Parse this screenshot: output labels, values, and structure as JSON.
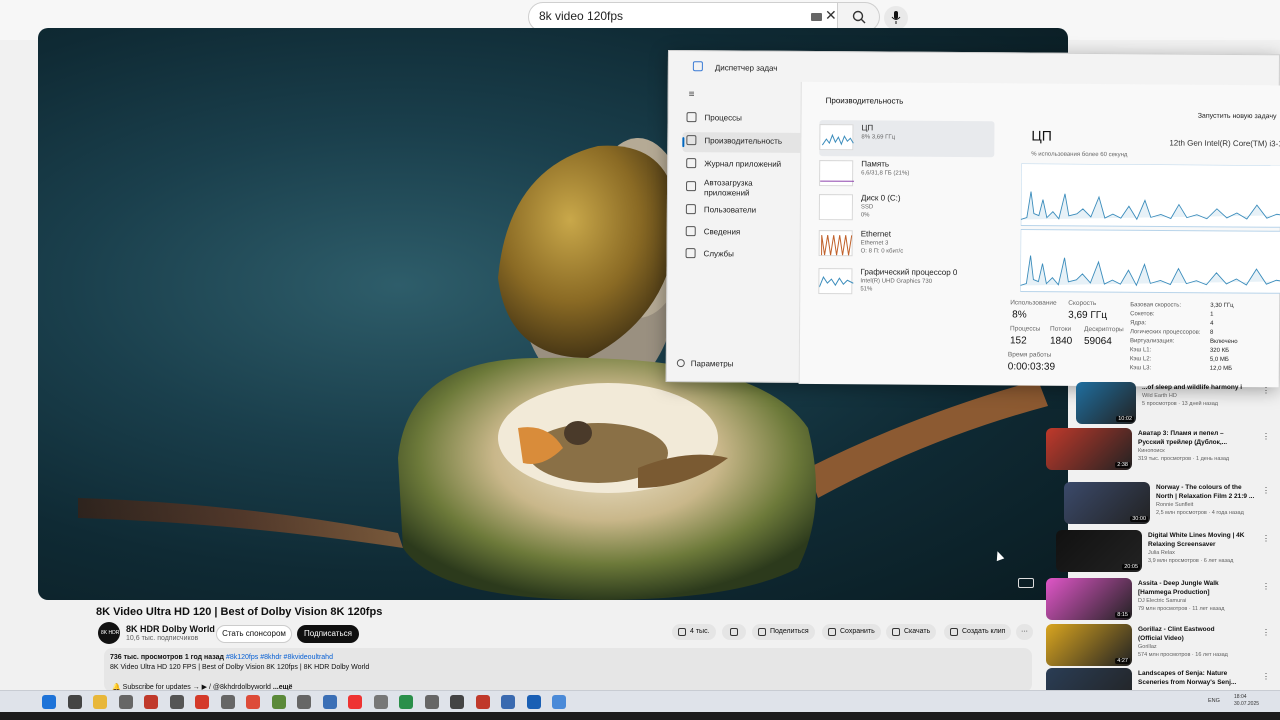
{
  "search": {
    "query": "8k video 120fps"
  },
  "video": {
    "title": "8K Video Ultra HD 120 | Best of Dolby Vision 8K 120fps",
    "channel": "8K HDR Dolby World",
    "subscribers": "10,6 тыс. подписчиков",
    "avatar_text": "8K HDR",
    "sponsor_label": "Стать спонсором",
    "subscribe_label": "Подписаться",
    "likes": "4 тыс.",
    "share_label": "Поделиться",
    "save_label": "Сохранить",
    "clip_label": "Скачать",
    "create_clip_label": "Создать клип",
    "more_label": "···",
    "views": "736 тыс. просмотров",
    "age": "1 год назад",
    "tags": "#8k120fps #8khdr #8kvideoultrahd",
    "desc_line": "8K Video Ultra HD 120 FPS | Best of Dolby Vision 8K 120fps | 8K HDR Dolby World",
    "desc_sub": "🔔 Subscribe for updates → ▶ / @8khdrdolbyworld",
    "desc_more": "...ещё"
  },
  "taskmgr": {
    "title": "Диспетчер задач",
    "menu_icon": "≡",
    "nav": [
      {
        "label": "Процессы",
        "icon": "processes-icon"
      },
      {
        "label": "Производительность",
        "icon": "performance-icon"
      },
      {
        "label": "Журнал приложений",
        "icon": "history-icon"
      },
      {
        "label": "Автозагрузка приложений",
        "icon": "startup-icon"
      },
      {
        "label": "Пользователи",
        "icon": "users-icon"
      },
      {
        "label": "Сведения",
        "icon": "details-icon"
      },
      {
        "label": "Службы",
        "icon": "services-icon"
      }
    ],
    "settings": "Параметры",
    "heading": "Производительность",
    "run_task": "Запустить новую задачу",
    "devices": [
      {
        "name": "ЦП",
        "sub1": "8%  3,69 ГГц",
        "sub2": ""
      },
      {
        "name": "Память",
        "sub1": "6,6/31,8 ГБ (21%)",
        "sub2": ""
      },
      {
        "name": "Диск 0 (C:)",
        "sub1": "SSD",
        "sub2": "0%"
      },
      {
        "name": "Ethernet",
        "sub1": "Ethernet 3",
        "sub2": "О: 8 П: 0 кбит/с"
      },
      {
        "name": "Графический процессор 0",
        "sub1": "Intel(R) UHD Graphics 730",
        "sub2": "51%"
      }
    ],
    "cpu": {
      "title": "ЦП",
      "model": "12th Gen Intel(R) Core(TM) i3-1",
      "util_label": "% использования более 60 секунд",
      "usage_label": "Использование",
      "usage": "8%",
      "speed_label": "Скорость",
      "speed": "3,69 ГГц",
      "proc_label": "Процессы",
      "processes": "152",
      "threads_label": "Потоки",
      "threads": "1840",
      "handles_label": "Дескрипторы",
      "handles": "59064",
      "uptime_label": "Время работы",
      "uptime": "0:00:03:39",
      "specs": [
        {
          "label": "Базовая скорость:",
          "value": "3,30 ГГц"
        },
        {
          "label": "Сокетов:",
          "value": "1"
        },
        {
          "label": "Ядра:",
          "value": "4"
        },
        {
          "label": "Логических процессоров:",
          "value": "8"
        },
        {
          "label": "Виртуализация:",
          "value": "Включено"
        },
        {
          "label": "Кэш L1:",
          "value": "320 КБ"
        },
        {
          "label": "Кэш L2:",
          "value": "5,0 МБ"
        },
        {
          "label": "Кэш L3:",
          "value": "12,0 МБ"
        }
      ]
    }
  },
  "recommendations": [
    {
      "title": "...of sleep and wildlife harmony i",
      "channel": "Wild Earth HD",
      "meta": "5 просмотров · 13 дней назад",
      "duration": "10:02",
      "color": "#1f6fa0"
    },
    {
      "title": "Аватар 3: Пламя и пепел –",
      "title2": "Русский трейлер (Дублок,...",
      "channel": "Кинопоиск",
      "meta": "319 тыс. просмотров · 1 день назад",
      "duration": "2:38",
      "color": "#c0392b"
    },
    {
      "title": "Norway - The colours of the",
      "title2": "North | Relaxation Film 2 21:9 ...",
      "channel": "Ronnie Sunfleit",
      "meta": "2,5 млн просмотров · 4 года назад",
      "duration": "30:00",
      "color": "#3b4a6b"
    },
    {
      "title": "Digital White Lines Moving | 4K",
      "title2": "Relaxing Screensaver",
      "channel": "Julia Relax",
      "meta": "3,9 млн просмотров · 6 лет назад",
      "duration": "20:05",
      "color": "#111111"
    },
    {
      "title": "Assita - Deep Jungle Walk",
      "title2": "[Hammega Production]",
      "channel": "DJ Electric Samurai",
      "meta": "79 млн просмотров · 11 лет назад",
      "duration": "8:15",
      "color": "#e056c8"
    },
    {
      "title": "Gorillaz - Clint Eastwood",
      "title2": "(Official Video)",
      "channel": "Gorillaz",
      "meta": "574 млн просмотров · 16 лет назад",
      "duration": "4:27",
      "color": "#d9a520"
    },
    {
      "title": "Landscapes of Senja: Nature",
      "title2": "Sceneries from Norway's Senj...",
      "channel": "",
      "meta": "",
      "duration": "",
      "color": "#2a3d55"
    }
  ],
  "taskbar": {
    "lang": "ENG",
    "time": "18:04",
    "date": "30.07.2025",
    "icons": [
      {
        "name": "windows-start-icon",
        "color": "#1e73d8"
      },
      {
        "name": "search-taskbar-icon",
        "color": "#444"
      },
      {
        "name": "file-explorer-icon",
        "color": "#e8b73a"
      },
      {
        "name": "app-icon",
        "color": "#666"
      },
      {
        "name": "app-icon",
        "color": "#c0392b"
      },
      {
        "name": "app-icon",
        "color": "#555"
      },
      {
        "name": "app-icon",
        "color": "#d43a2a"
      },
      {
        "name": "app-icon",
        "color": "#666"
      },
      {
        "name": "chrome-icon",
        "color": "#dd4b39"
      },
      {
        "name": "app-icon",
        "color": "#5b8a3a"
      },
      {
        "name": "app-icon",
        "color": "#666"
      },
      {
        "name": "app-icon",
        "color": "#3b6fb6"
      },
      {
        "name": "app-icon",
        "color": "#e33"
      },
      {
        "name": "app-icon",
        "color": "#777"
      },
      {
        "name": "app-icon",
        "color": "#2a8f4a"
      },
      {
        "name": "app-icon",
        "color": "#666"
      },
      {
        "name": "app-icon",
        "color": "#444"
      },
      {
        "name": "app-icon",
        "color": "#c0392b"
      },
      {
        "name": "app-icon",
        "color": "#3a6ab0"
      },
      {
        "name": "info-icon",
        "color": "#1a5fb4"
      },
      {
        "name": "task-manager-icon",
        "color": "#4a8ad8"
      }
    ]
  }
}
